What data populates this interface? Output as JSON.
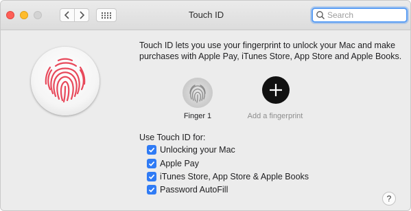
{
  "window": {
    "title": "Touch ID"
  },
  "search": {
    "placeholder": "Search",
    "value": ""
  },
  "description": "Touch ID lets you use your fingerprint to unlock your Mac and make purchases with Apple Pay, iTunes Store, App Store and Apple Books.",
  "fingers": [
    {
      "label": "Finger 1",
      "icon": "fingerprint-icon"
    },
    {
      "label": "Add a fingerprint",
      "icon": "plus-icon"
    }
  ],
  "use_for": {
    "heading": "Use Touch ID for:",
    "options": [
      {
        "label": "Unlocking your Mac",
        "checked": true
      },
      {
        "label": "Apple Pay",
        "checked": true
      },
      {
        "label": "iTunes Store, App Store & Apple Books",
        "checked": true
      },
      {
        "label": "Password AutoFill",
        "checked": true
      }
    ]
  },
  "help": {
    "label": "?"
  },
  "colors": {
    "accent": "#2f7bf5",
    "fingerprint": "#e8495b"
  }
}
